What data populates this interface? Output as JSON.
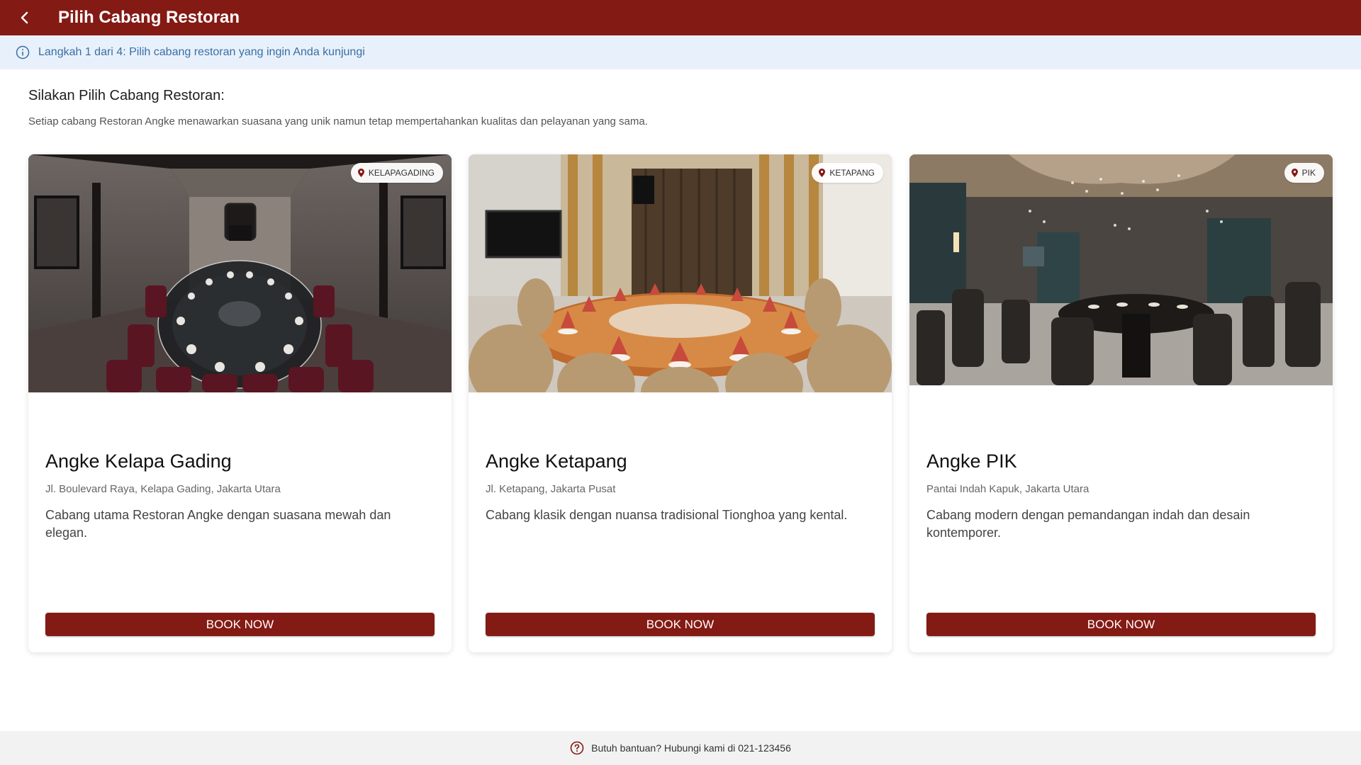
{
  "header": {
    "title": "Pilih Cabang Restoran",
    "back_icon": "chevron-left-icon",
    "color": "#841a14"
  },
  "step_bar": {
    "text": "Langkah 1 dari 4: Pilih cabang restoran yang ingin Anda kunjungi",
    "icon": "info-icon"
  },
  "main": {
    "heading": "Silakan Pilih Cabang Restoran:",
    "subheading": "Setiap cabang Restoran Angke menawarkan suasana yang unik namun tetap mempertahankan kualitas dan pelayanan yang sama."
  },
  "branches": [
    {
      "badge": "KELAPAGADING",
      "name": "Angke Kelapa Gading",
      "address": "Jl. Boulevard Raya, Kelapa Gading, Jakarta Utara",
      "description": "Cabang utama Restoran Angke dengan suasana mewah dan elegan.",
      "button": "BOOK NOW"
    },
    {
      "badge": "KETAPANG",
      "name": "Angke Ketapang",
      "address": "Jl. Ketapang, Jakarta Pusat",
      "description": "Cabang klasik dengan nuansa tradisional Tionghoa yang kental.",
      "button": "BOOK NOW"
    },
    {
      "badge": "PIK",
      "name": "Angke PIK",
      "address": "Pantai Indah Kapuk, Jakarta Utara",
      "description": "Cabang modern dengan pemandangan indah dan desain kontemporer.",
      "button": "BOOK NOW"
    }
  ],
  "footer": {
    "text": "Butuh bantuan? Hubungi kami di 021-123456",
    "icon": "help-circle-icon"
  }
}
